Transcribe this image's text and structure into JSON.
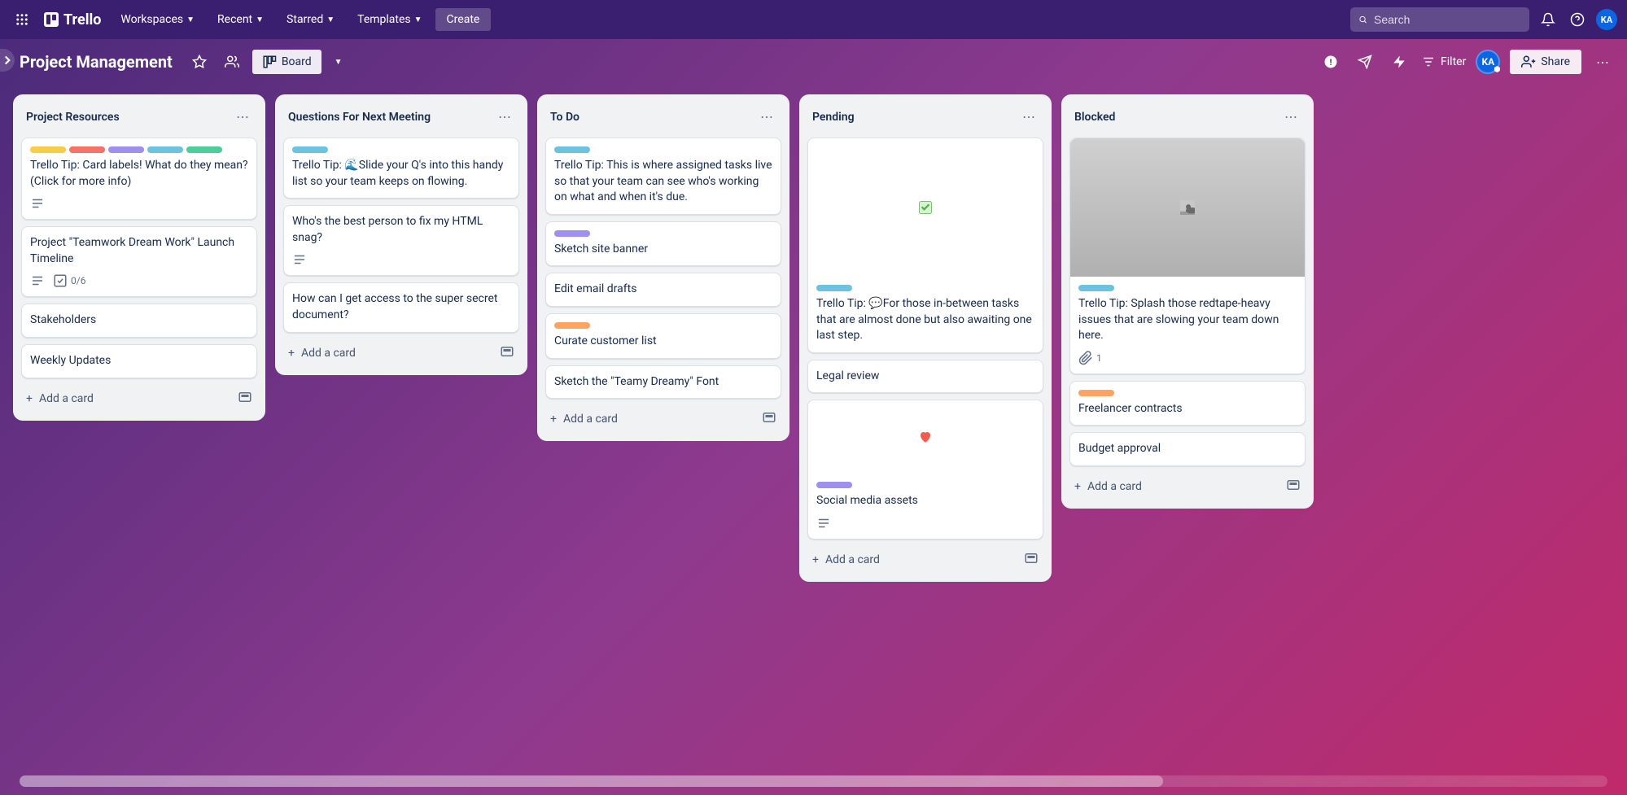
{
  "topbar": {
    "logo": "Trello",
    "nav": [
      "Workspaces",
      "Recent",
      "Starred",
      "Templates"
    ],
    "create": "Create",
    "search_placeholder": "Search",
    "avatar": "KA"
  },
  "boardbar": {
    "title": "Project Management",
    "view": "Board",
    "filter": "Filter",
    "share": "Share",
    "member": "KA"
  },
  "add_card_label": "Add a card",
  "lists": [
    {
      "title": "Project Resources",
      "cards": [
        {
          "labels": [
            "yellow",
            "red",
            "purple",
            "sky",
            "green"
          ],
          "text": "Trello Tip: Card labels! What do they mean? (Click for more info)",
          "badges": {
            "desc": true
          }
        },
        {
          "text": "Project \"Teamwork Dream Work\" Launch Timeline",
          "badges": {
            "desc": true,
            "checklist": "0/6"
          }
        },
        {
          "text": "Stakeholders"
        },
        {
          "text": "Weekly Updates"
        }
      ]
    },
    {
      "title": "Questions For Next Meeting",
      "cards": [
        {
          "labels": [
            "sky"
          ],
          "text": "Trello Tip: 🌊Slide your Q's into this handy list so your team keeps on flowing."
        },
        {
          "text": "Who's the best person to fix my HTML snag?",
          "badges": {
            "desc": true
          }
        },
        {
          "text": "How can I get access to the super secret document?"
        }
      ]
    },
    {
      "title": "To Do",
      "cards": [
        {
          "labels": [
            "sky"
          ],
          "text": "Trello Tip: This is where assigned tasks live so that your team can see who's working on what and when it's due."
        },
        {
          "labels": [
            "purple"
          ],
          "text": "Sketch site banner"
        },
        {
          "text": "Edit email drafts"
        },
        {
          "labels": [
            "orange"
          ],
          "text": "Curate customer list"
        },
        {
          "text": "Sketch the \"Teamy Dreamy\" Font"
        }
      ]
    },
    {
      "title": "Pending",
      "cards": [
        {
          "cover": "check",
          "labels": [
            "sky"
          ],
          "text": "Trello Tip: 💬For those in-between tasks that are almost done but also awaiting one last step."
        },
        {
          "text": "Legal review"
        },
        {
          "cover": "heart",
          "labels": [
            "purple"
          ],
          "text": "Social media assets",
          "badges": {
            "desc": true
          }
        }
      ]
    },
    {
      "title": "Blocked",
      "cards": [
        {
          "cover": "cat",
          "labels": [
            "sky"
          ],
          "text": "Trello Tip: Splash those redtape-heavy issues that are slowing your team down here.",
          "badges": {
            "attachment": "1"
          }
        },
        {
          "labels": [
            "orange"
          ],
          "text": "Freelancer contracts"
        },
        {
          "text": "Budget approval"
        }
      ]
    }
  ]
}
